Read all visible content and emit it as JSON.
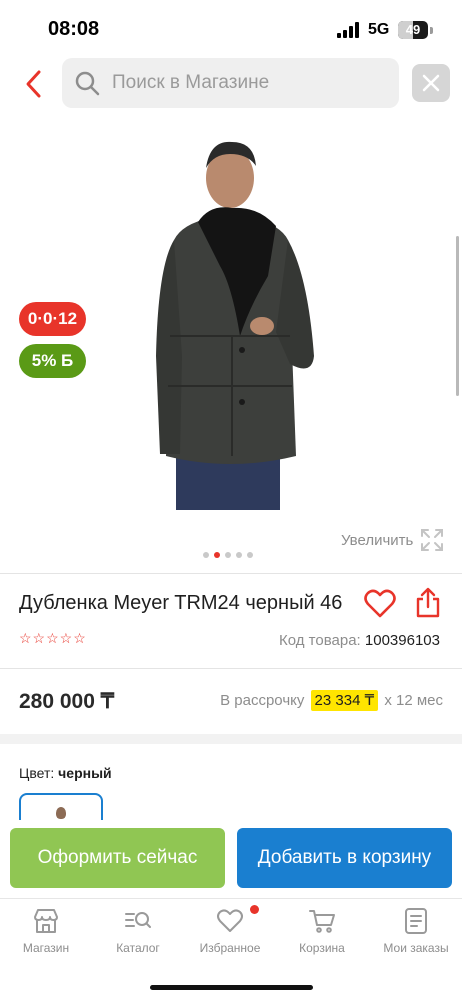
{
  "status_bar": {
    "time": "08:08",
    "network": "5G",
    "battery": "49"
  },
  "search": {
    "placeholder": "Поиск в Магазине"
  },
  "gallery": {
    "promo_badge": "0·0·12",
    "bonus_badge": "5% Б",
    "zoom_label": "Увеличить",
    "dots_count": 5,
    "active_dot": 1
  },
  "product": {
    "title": "Дубленка Meyer TRM24 черный 46",
    "rating_stars": "☆☆☆☆☆",
    "sku_label": "Код товара:",
    "sku_value": "100396103",
    "price": "280 000 ₸",
    "installment_prefix": "В рассрочку",
    "installment_amount": "23 334 ₸",
    "installment_suffix": "х 12 мес",
    "color_label": "Цвет:",
    "color_value": "черный"
  },
  "actions": {
    "checkout_label": "Оформить сейчас",
    "add_to_cart_label": "Добавить в корзину"
  },
  "bottom_nav": {
    "items": [
      {
        "label": "Магазин",
        "icon": "store-icon"
      },
      {
        "label": "Каталог",
        "icon": "catalog-search-icon"
      },
      {
        "label": "Избранное",
        "icon": "heart-icon"
      },
      {
        "label": "Корзина",
        "icon": "cart-icon"
      },
      {
        "label": "Мои заказы",
        "icon": "orders-icon"
      }
    ]
  },
  "colors": {
    "accent_red": "#e8342a",
    "primary_blue": "#1a7fd0",
    "checkout_green": "#8bc34a",
    "bonus_green": "#5a9a16",
    "installment_yellow": "#ffe500"
  }
}
